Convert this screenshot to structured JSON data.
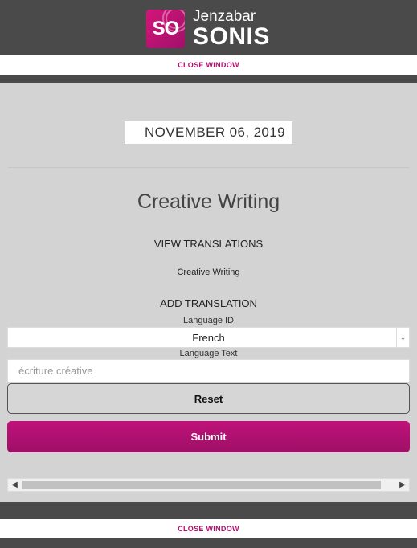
{
  "header": {
    "logo_mark": "SO",
    "brand": "Jenzabar",
    "product": "SONIS"
  },
  "close_window_label": "CLOSE WINDOW",
  "date": "NOVEMBER 06, 2019",
  "course_title": "Creative Writing",
  "view_translations": {
    "heading": "VIEW TRANSLATIONS",
    "items": [
      "Creative Writing"
    ]
  },
  "add_translation": {
    "heading": "ADD TRANSLATION",
    "language_id_label": "Language ID",
    "language_id_value": "French",
    "language_text_label": "Language Text",
    "language_text_value": "écriture créative"
  },
  "buttons": {
    "reset": "Reset",
    "submit": "Submit"
  },
  "colors": {
    "accent": "#b0116f",
    "chrome": "#4a4a4a",
    "panel": "#d3d3d3"
  }
}
